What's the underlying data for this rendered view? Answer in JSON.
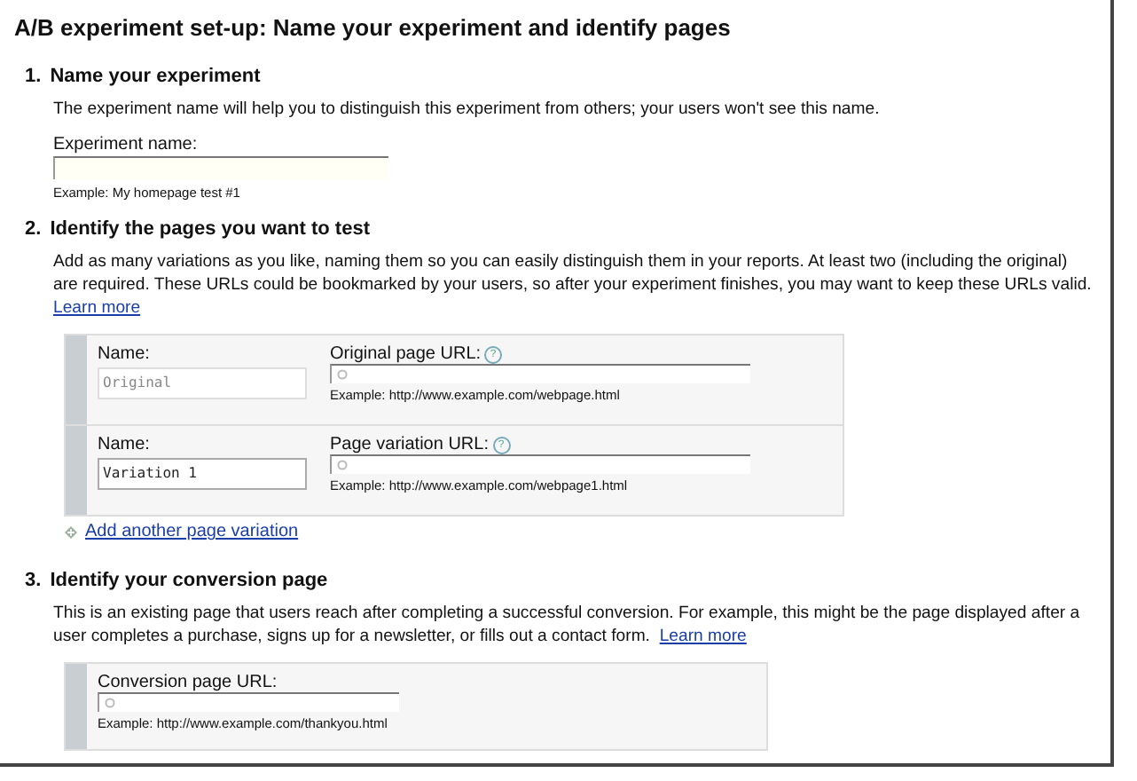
{
  "title": "A/B experiment set-up: Name your experiment and identify pages",
  "sections": [
    {
      "number": "1.",
      "heading": "Name your experiment",
      "description": "The experiment name will help you to distinguish this experiment from others; your users won't see this name.",
      "field": {
        "label": "Experiment name:",
        "example": "Example: My homepage test #1"
      }
    },
    {
      "number": "2.",
      "heading": "Identify the pages you want to test",
      "description": "Add as many variations as you like, naming them so you can easily distinguish them in your reports. At least two (including the original) are required. These URLs could be bookmarked by your users, so after your experiment finishes, you may want to keep these URLs valid.",
      "link": "Learn more",
      "variations": [
        {
          "name_label": "Name:",
          "name_value": "Original",
          "name_disabled": true,
          "url_label": "Original page URL:",
          "help": "?",
          "example": "Example: http://www.example.com/webpage.html"
        },
        {
          "name_label": "Name:",
          "name_value": "Variation 1",
          "name_disabled": false,
          "url_label": "Page variation URL:",
          "help": "?",
          "example": "Example: http://www.example.com/webpage1.html"
        }
      ],
      "add_link": "Add another page variation"
    },
    {
      "number": "3.",
      "heading": "Identify your conversion page",
      "description": "This is an existing page that users reach after completing a successful conversion. For example, this might be the page displayed after a user completes a purchase, signs up for a newsletter, or fills out a contact form.",
      "link": "Learn more",
      "conversion": {
        "label": "Conversion page URL:",
        "example": "Example: http://www.example.com/thankyou.html"
      }
    }
  ]
}
